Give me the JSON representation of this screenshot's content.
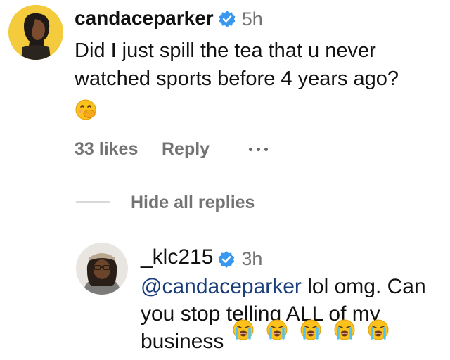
{
  "comment": {
    "username": "candaceparker",
    "time": "5h",
    "text_line1": "Did I just spill the tea that u never",
    "text_line2": "watched sports before 4 years ago?",
    "likes": "33 likes",
    "reply_label": "Reply",
    "emoji": "face-with-hand-over-mouth"
  },
  "hide_replies_label": "Hide all replies",
  "reply_comment": {
    "username": "_klc215",
    "time": "3h",
    "mention": "@candaceparker",
    "text_line1_rest": " lol omg. Can",
    "text_line2": "you stop telling ALL of my",
    "text_line3": "business",
    "emojis": [
      "loudly-crying-face",
      "loudly-crying-face",
      "loudly-crying-face",
      "loudly-crying-face",
      "loudly-crying-face"
    ]
  },
  "colors": {
    "verified": "#3897f0",
    "secondary_text": "#737373",
    "mention": "#1a3d7c"
  }
}
